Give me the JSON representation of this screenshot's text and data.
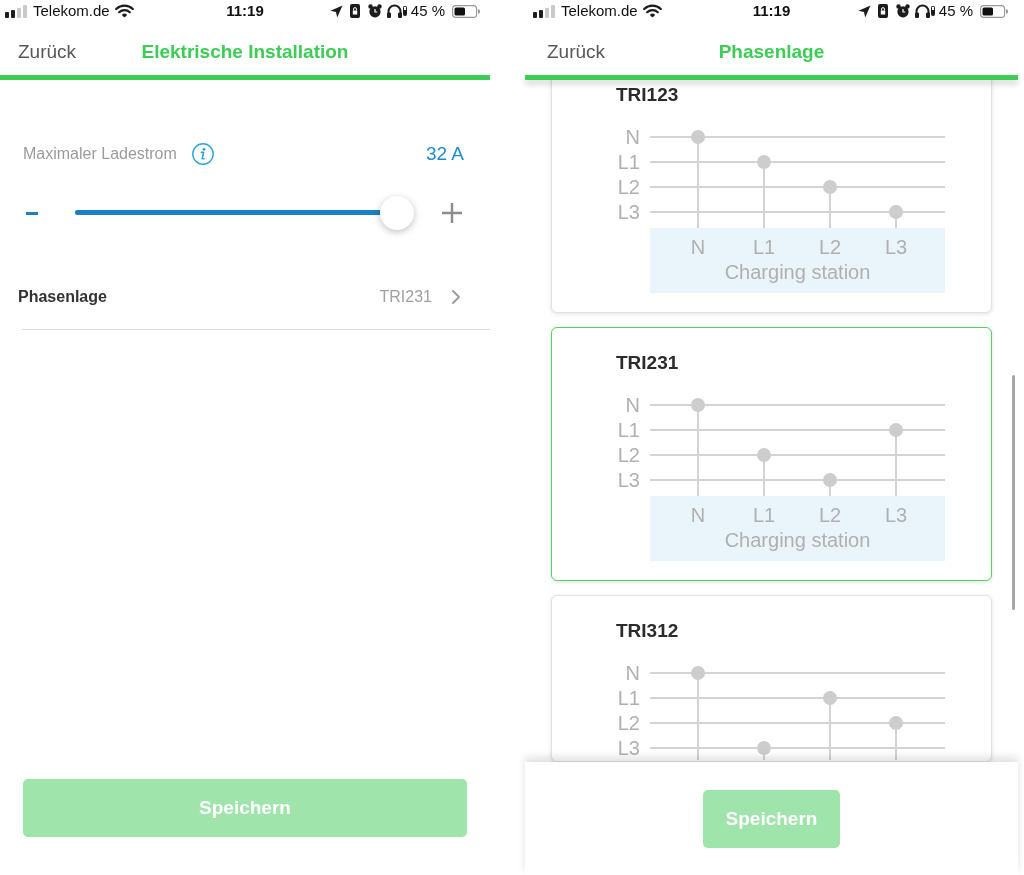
{
  "screens": [
    {
      "kind": "settings",
      "status_bar": {
        "carrier": "Telekom.de",
        "time": "11:19",
        "battery": "45 %"
      },
      "nav": {
        "back": "Zurück",
        "title": "Elektrische Installation"
      },
      "current_setting": {
        "label": "Maximaler Ladestrom",
        "value": "32 A",
        "level": 1
      },
      "rows": [
        {
          "label": "Phasenlage",
          "value": "TRI231"
        }
      ],
      "save_button": {
        "label": "Speichern"
      }
    },
    {
      "kind": "phase_list",
      "status_bar": {
        "carrier": "Telekom.de",
        "time": "11:19",
        "battery": "45 %"
      },
      "nav": {
        "back": "Zurück",
        "title": "Phasenlage"
      },
      "options": [
        {
          "title": "TRI123",
          "selected": false,
          "lines": [
            "N",
            "L1",
            "L2",
            "L3"
          ],
          "terminals": [
            {
              "label": "N",
              "kind": "to_n"
            },
            {
              "label": "L1",
              "kind": "to_l1"
            },
            {
              "label": "L2",
              "kind": "to_l2"
            },
            {
              "label": "L3",
              "kind": "to_l3"
            }
          ],
          "station": "Charging station"
        },
        {
          "title": "TRI231",
          "selected": true,
          "lines": [
            "N",
            "L1",
            "L2",
            "L3"
          ],
          "terminals": [
            {
              "label": "N",
              "kind": "to_n"
            },
            {
              "label": "L1",
              "kind": "to_l2"
            },
            {
              "label": "L2",
              "kind": "to_l3"
            },
            {
              "label": "L3",
              "kind": "to_l1"
            }
          ],
          "station": "Charging station"
        },
        {
          "title": "TRI312",
          "selected": false,
          "lines": [
            "N",
            "L1",
            "L2",
            "L3"
          ],
          "terminals": [
            {
              "kind": "to_n"
            },
            {
              "kind": "to_l3"
            },
            {
              "kind": "to_l1"
            },
            {
              "kind": "to_l2"
            }
          ]
        }
      ],
      "save_button": {
        "label": "Speichern"
      }
    }
  ]
}
